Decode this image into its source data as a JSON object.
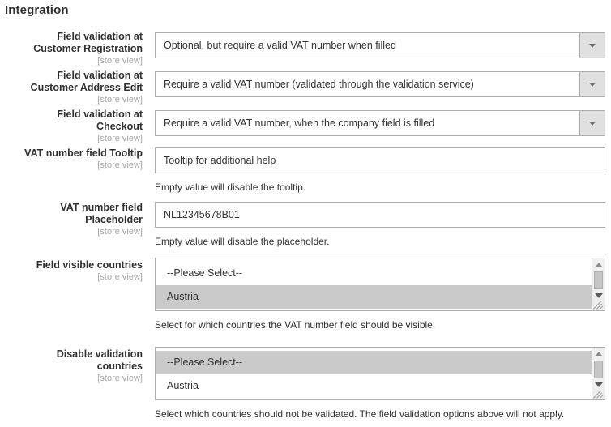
{
  "section": {
    "title": "Integration"
  },
  "scope_label": "[store view]",
  "fields": [
    {
      "label_line1": "Field validation at",
      "label_line2": "Customer Registration",
      "scope": "[store view]",
      "type": "select",
      "value": "Optional, but require a valid VAT number when filled"
    },
    {
      "label_line1": "Field validation at",
      "label_line2": "Customer Address Edit",
      "scope": "[store view]",
      "type": "select",
      "value": "Require a valid VAT number (validated through the validation service)"
    },
    {
      "label_line1": "Field validation at",
      "label_line2": "Checkout",
      "scope": "[store view]",
      "type": "select",
      "value": "Require a valid VAT number, when the company field is filled"
    },
    {
      "label_line1": "VAT number field Tooltip",
      "label_line2": "",
      "scope": "[store view]",
      "type": "text",
      "value": "Tooltip for additional help",
      "note": "Empty value will disable the tooltip."
    },
    {
      "label_line1": "VAT number field",
      "label_line2": "Placeholder",
      "scope": "[store view]",
      "type": "text",
      "value": "NL12345678B01",
      "note": "Empty value will disable the placeholder."
    },
    {
      "label_line1": "Field visible countries",
      "label_line2": "",
      "scope": "[store view]",
      "type": "multiselect",
      "options": [
        {
          "label": "--Please Select--",
          "selected": false
        },
        {
          "label": "Austria",
          "selected": true
        }
      ],
      "note": "Select for which countries the VAT number field should be visible."
    },
    {
      "label_line1": "Disable validation",
      "label_line2": "countries",
      "scope": "[store view]",
      "type": "multiselect",
      "options": [
        {
          "label": "--Please Select--",
          "selected": true
        },
        {
          "label": "Austria",
          "selected": false
        }
      ],
      "note": "Select which countries should not be validated. The field validation options above will not apply."
    }
  ],
  "icons": {
    "dropdown": "chevron-down-icon",
    "scroll_up": "scroll-up-arrow-icon",
    "scroll_down": "scroll-down-arrow-icon",
    "resize": "resize-grip-icon"
  },
  "colors": {
    "border": "#adadad",
    "selected_option": "#cacaca",
    "label_text": "#303030",
    "scope_text": "#a6a6a6"
  }
}
